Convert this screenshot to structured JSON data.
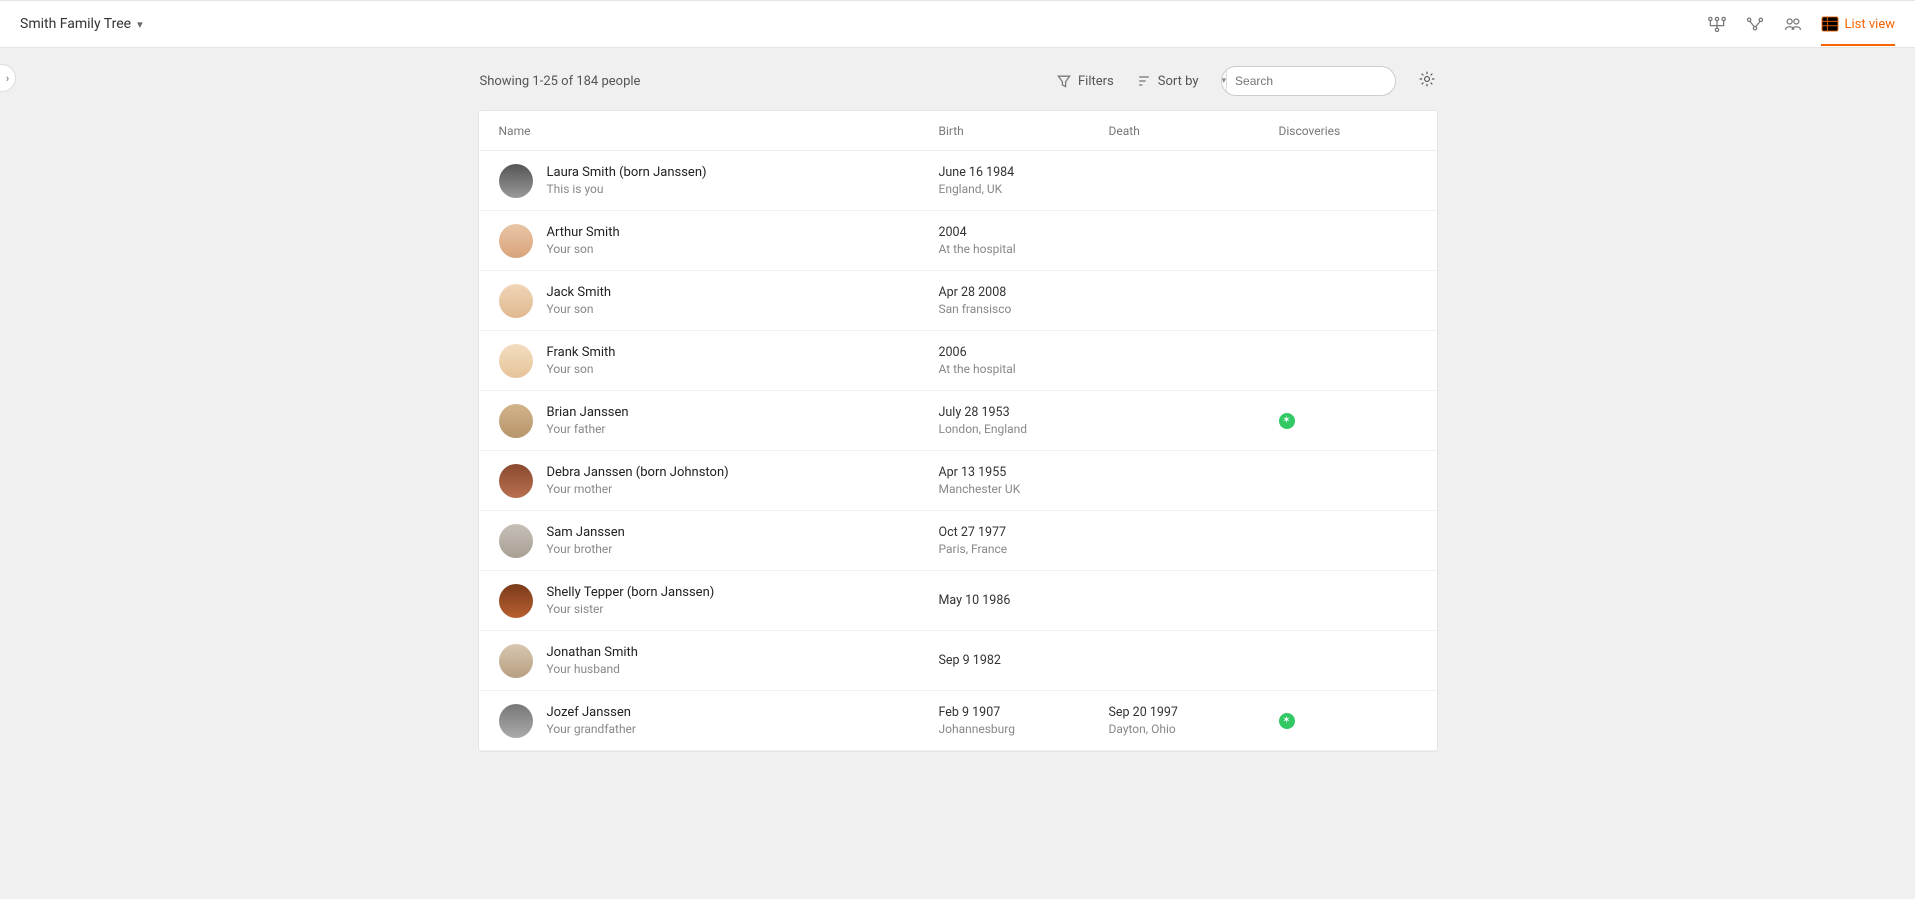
{
  "header": {
    "tree_title": "Smith Family Tree",
    "list_view_label": "List view"
  },
  "toolbar": {
    "showing_text": "Showing 1-25 of 184 people",
    "filters_label": "Filters",
    "sortby_label": "Sort by",
    "search_placeholder": "Search"
  },
  "columns": {
    "name": "Name",
    "birth": "Birth",
    "death": "Death",
    "discoveries": "Discoveries"
  },
  "people": [
    {
      "name": "Laura Smith (born Janssen)",
      "relation": "This is you",
      "birth_date": "June 16 1984",
      "birth_place": "England, UK",
      "death_date": "",
      "death_place": "",
      "has_discovery": false
    },
    {
      "name": "Arthur Smith",
      "relation": "Your son",
      "birth_date": "2004",
      "birth_place": "At the hospital",
      "death_date": "",
      "death_place": "",
      "has_discovery": false
    },
    {
      "name": "Jack Smith",
      "relation": "Your son",
      "birth_date": "Apr 28 2008",
      "birth_place": "San fransisco",
      "death_date": "",
      "death_place": "",
      "has_discovery": false
    },
    {
      "name": "Frank Smith",
      "relation": "Your son",
      "birth_date": "2006",
      "birth_place": "At the hospital",
      "death_date": "",
      "death_place": "",
      "has_discovery": false
    },
    {
      "name": "Brian Janssen",
      "relation": "Your father",
      "birth_date": "July 28 1953",
      "birth_place": "London, England",
      "death_date": "",
      "death_place": "",
      "has_discovery": true
    },
    {
      "name": "Debra Janssen (born Johnston)",
      "relation": "Your mother",
      "birth_date": "Apr 13 1955",
      "birth_place": "Manchester UK",
      "death_date": "",
      "death_place": "",
      "has_discovery": false
    },
    {
      "name": "Sam Janssen",
      "relation": "Your brother",
      "birth_date": "Oct 27 1977",
      "birth_place": "Paris, France",
      "death_date": "",
      "death_place": "",
      "has_discovery": false
    },
    {
      "name": "Shelly Tepper (born Janssen)",
      "relation": "Your sister",
      "birth_date": "May 10 1986",
      "birth_place": "",
      "death_date": "",
      "death_place": "",
      "has_discovery": false
    },
    {
      "name": "Jonathan Smith",
      "relation": "Your husband",
      "birth_date": "Sep 9 1982",
      "birth_place": "",
      "death_date": "",
      "death_place": "",
      "has_discovery": false
    },
    {
      "name": "Jozef Janssen",
      "relation": "Your grandfather",
      "birth_date": "Feb 9 1907",
      "birth_place": "Johannesburg",
      "death_date": "Sep 20 1997",
      "death_place": "Dayton, Ohio",
      "has_discovery": true
    }
  ]
}
